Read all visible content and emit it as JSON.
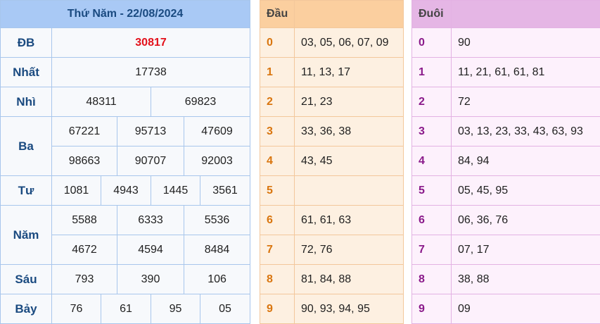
{
  "title": "Thứ Năm - 22/08/2024",
  "prizes": {
    "db": {
      "label": "ĐB",
      "values": [
        "30817"
      ]
    },
    "nhat": {
      "label": "Nhất",
      "values": [
        "17738"
      ]
    },
    "nhi": {
      "label": "Nhì",
      "values": [
        "48311",
        "69823"
      ]
    },
    "ba": {
      "label": "Ba",
      "values": [
        "67221",
        "95713",
        "47609",
        "98663",
        "90707",
        "92003"
      ]
    },
    "tu": {
      "label": "Tư",
      "values": [
        "1081",
        "4943",
        "1445",
        "3561"
      ]
    },
    "nam": {
      "label": "Năm",
      "values": [
        "5588",
        "6333",
        "5536",
        "4672",
        "4594",
        "8484"
      ]
    },
    "sau": {
      "label": "Sáu",
      "values": [
        "793",
        "390",
        "106"
      ]
    },
    "bay": {
      "label": "Bảy",
      "values": [
        "76",
        "61",
        "95",
        "05"
      ]
    }
  },
  "dau": {
    "header": "Đầu",
    "rows": [
      {
        "k": "0",
        "v": "03, 05, 06, 07, 09"
      },
      {
        "k": "1",
        "v": "11, 13, 17"
      },
      {
        "k": "2",
        "v": "21, 23"
      },
      {
        "k": "3",
        "v": "33, 36, 38"
      },
      {
        "k": "4",
        "v": "43, 45"
      },
      {
        "k": "5",
        "v": ""
      },
      {
        "k": "6",
        "v": "61, 61, 63"
      },
      {
        "k": "7",
        "v": "72, 76"
      },
      {
        "k": "8",
        "v": "81, 84, 88"
      },
      {
        "k": "9",
        "v": "90, 93, 94, 95"
      }
    ]
  },
  "duoi": {
    "header": "Đuôi",
    "rows": [
      {
        "k": "0",
        "v": "90"
      },
      {
        "k": "1",
        "v": "11, 21, 61, 61, 81"
      },
      {
        "k": "2",
        "v": "72"
      },
      {
        "k": "3",
        "v": "03, 13, 23, 33, 43, 63, 93"
      },
      {
        "k": "4",
        "v": "84, 94"
      },
      {
        "k": "5",
        "v": "05, 45, 95"
      },
      {
        "k": "6",
        "v": "06, 36, 76"
      },
      {
        "k": "7",
        "v": "07, 17"
      },
      {
        "k": "8",
        "v": "38, 88"
      },
      {
        "k": "9",
        "v": "09"
      }
    ]
  }
}
